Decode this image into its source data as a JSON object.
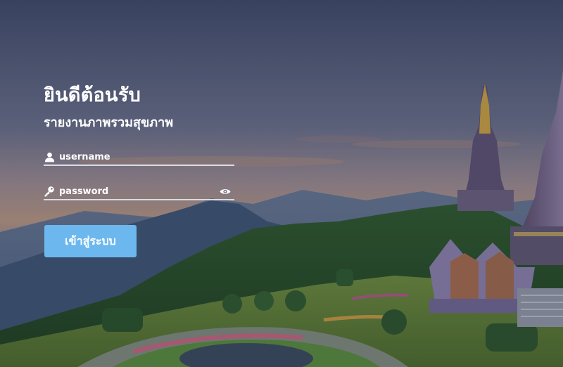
{
  "login": {
    "welcome_text": "ยินดีต้อนรับ",
    "subtitle": "รายงานภาพรวมสุขภาพ",
    "username_placeholder": "username",
    "password_placeholder": "password",
    "submit_label": "เข้าสู่ระบบ"
  },
  "icons": {
    "username": "user-icon",
    "password": "key-icon",
    "toggle": "eye-icon"
  },
  "colors": {
    "button": "#6cb8ee",
    "text": "#ffffff",
    "underline": "#d8dde6"
  }
}
